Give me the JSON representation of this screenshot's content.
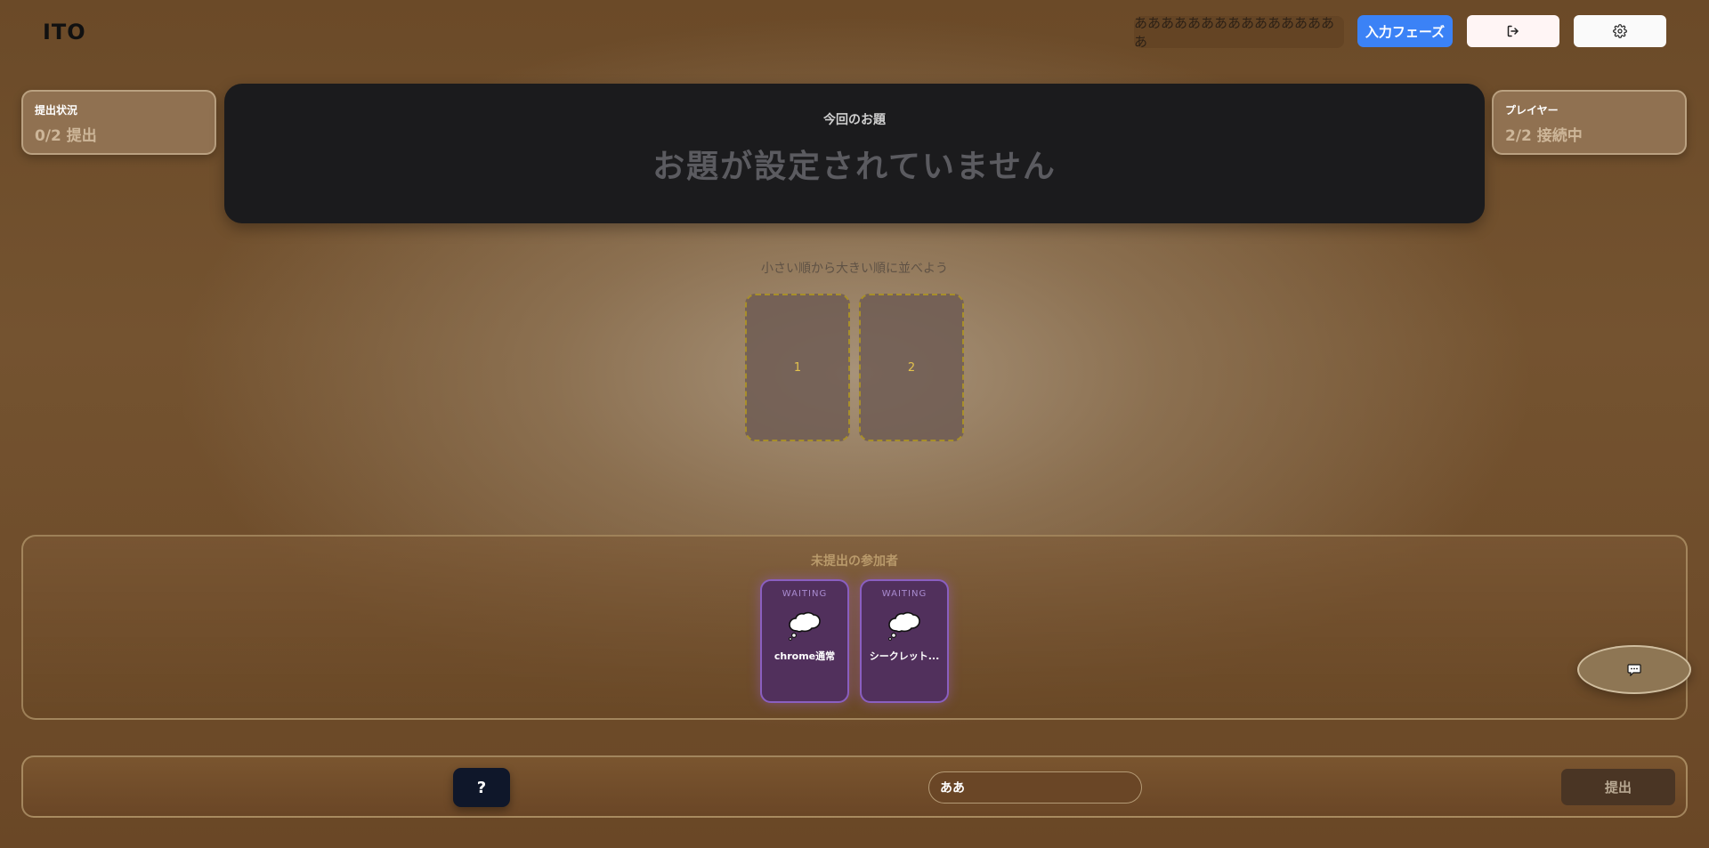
{
  "header": {
    "logo": "ITO",
    "username": "ああああああああああああああああ",
    "phase_button": "入力フェーズ",
    "logout_icon": "logout-icon",
    "settings_icon": "gear-icon"
  },
  "status_card": {
    "title": "提出状況",
    "value": "0/2 提出"
  },
  "player_card": {
    "title": "プレイヤー",
    "value": "2/2 接続中"
  },
  "topic": {
    "label": "今回のお題",
    "title": "お題が設定されていません"
  },
  "instruction": "小さい順から大きい順に並べよう",
  "slots": [
    "1",
    "2"
  ],
  "pending": {
    "title": "未提出の参加者",
    "players": [
      {
        "status": "WAITING",
        "name": "chrome通常",
        "icon": "thought-bubble-icon"
      },
      {
        "status": "WAITING",
        "name": "シークレット...",
        "icon": "thought-bubble-icon"
      }
    ]
  },
  "chat": {
    "icon": "chat-icon"
  },
  "bottom": {
    "help_label": "?",
    "answer_value": "ああ",
    "submit_label": "提出"
  },
  "colors": {
    "phase_accent": "#3b82f6",
    "topic_bg": "#1b1b1d",
    "waiting_card": "#51305c",
    "help_bg": "#0f172a"
  }
}
